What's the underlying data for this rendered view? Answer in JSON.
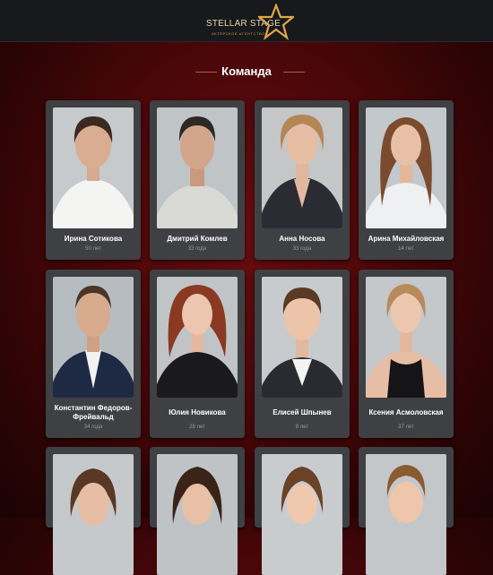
{
  "header": {
    "brand": "STELLAR STAGE",
    "tagline": "АКТЁРСКОЕ АГЕНТСТВО",
    "icon": "star-icon",
    "colors": {
      "bar": "#17191c",
      "gold": "#e0a848"
    }
  },
  "section": {
    "title": "Команда"
  },
  "team": [
    {
      "name": "Ирина Сотикова",
      "age": "50 лет"
    },
    {
      "name": "Дмитрий Комлев",
      "age": "33 года"
    },
    {
      "name": "Анна Носова",
      "age": "33 года"
    },
    {
      "name": "Арина Михайловская",
      "age": "14 лет"
    },
    {
      "name": "Константин Федоров-Фрейвальд",
      "age": "34 года"
    },
    {
      "name": "Юлия Новикова",
      "age": "28 лет"
    },
    {
      "name": "Елисей Шпынев",
      "age": "8 лет"
    },
    {
      "name": "Ксения Асмоловская",
      "age": "37 лет"
    }
  ]
}
